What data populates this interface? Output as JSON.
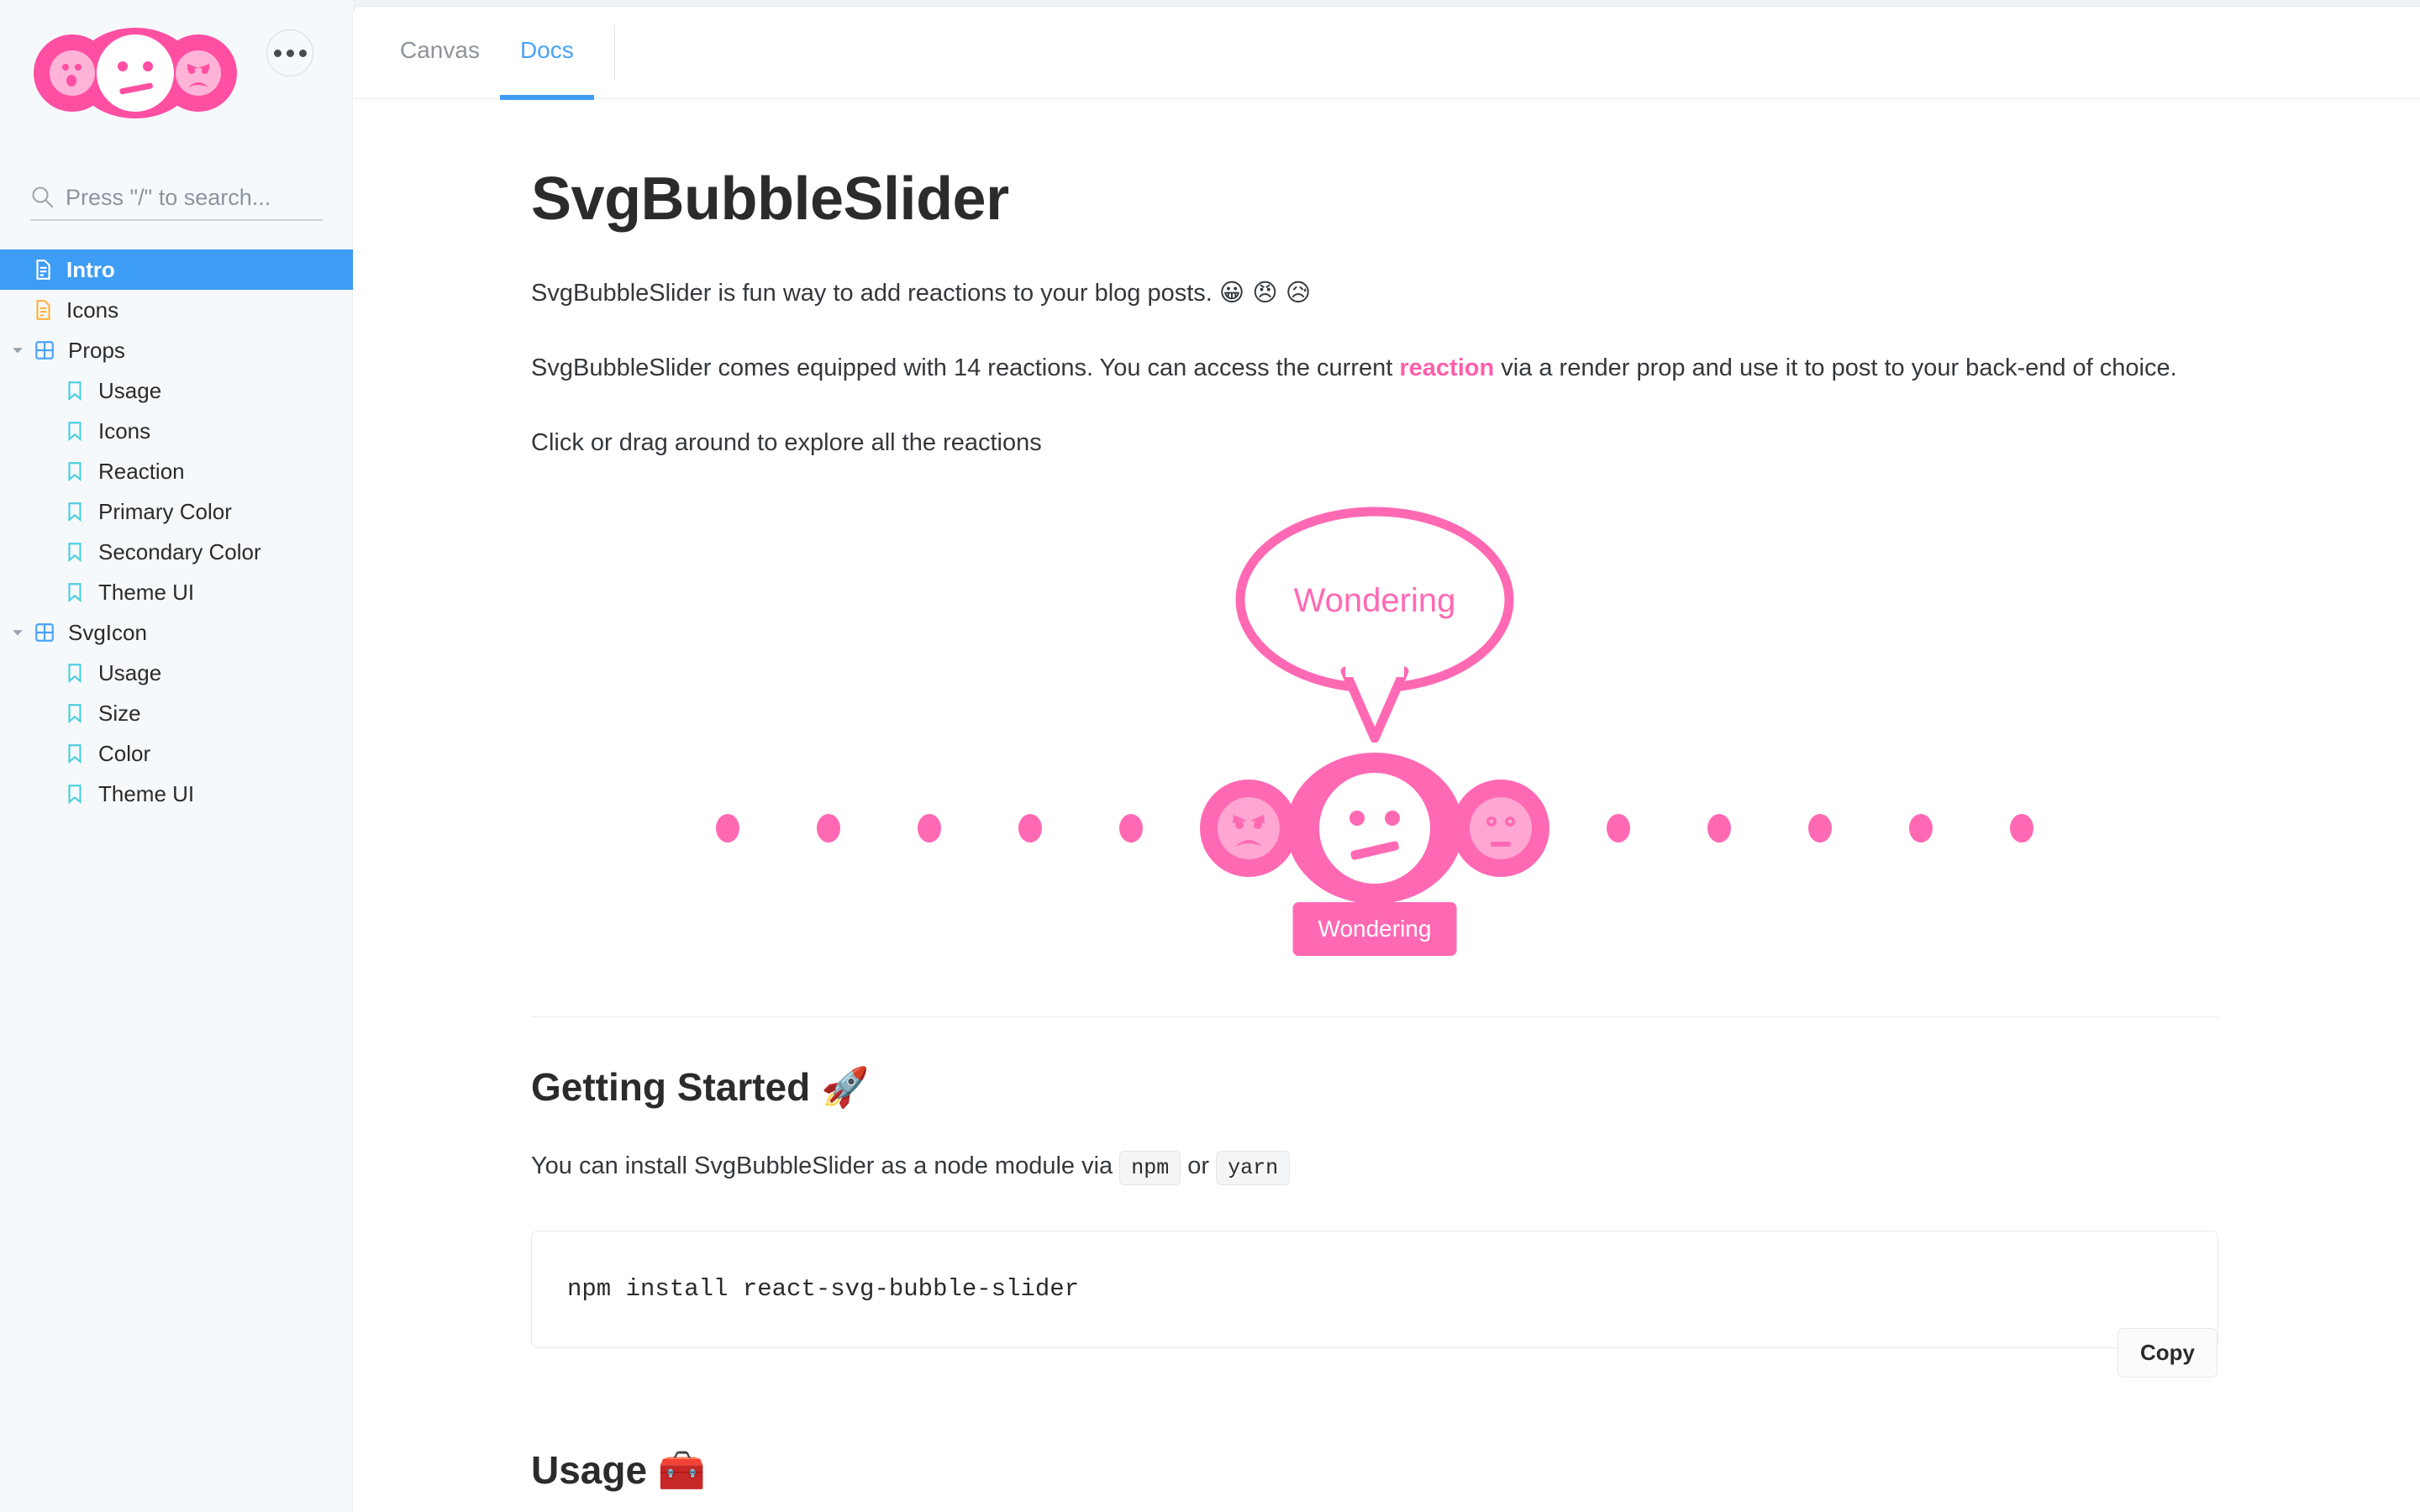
{
  "sidebar": {
    "logo_icon": "bubble-faces-logo",
    "more_button_icon": "ellipsis-icon",
    "search": {
      "icon": "search-icon",
      "placeholder": "Press \"/\" to search...",
      "value": ""
    },
    "items": [
      {
        "label": "Intro",
        "icon": "document-icon",
        "depth": 0,
        "active": true,
        "caret": false,
        "icon_color": "#ffffff"
      },
      {
        "label": "Icons",
        "icon": "document-icon",
        "depth": 0,
        "active": false,
        "caret": false,
        "icon_color": "#ffb23e"
      },
      {
        "label": "Props",
        "icon": "component-icon",
        "depth": 0,
        "active": false,
        "caret": true,
        "icon_color": "#4aa3f8"
      },
      {
        "label": "Usage",
        "icon": "bookmark-icon",
        "depth": 1,
        "active": false,
        "caret": false,
        "icon_color": "#4ecfe0"
      },
      {
        "label": "Icons",
        "icon": "bookmark-icon",
        "depth": 1,
        "active": false,
        "caret": false,
        "icon_color": "#4ecfe0"
      },
      {
        "label": "Reaction",
        "icon": "bookmark-icon",
        "depth": 1,
        "active": false,
        "caret": false,
        "icon_color": "#4ecfe0"
      },
      {
        "label": "Primary Color",
        "icon": "bookmark-icon",
        "depth": 1,
        "active": false,
        "caret": false,
        "icon_color": "#4ecfe0"
      },
      {
        "label": "Secondary Color",
        "icon": "bookmark-icon",
        "depth": 1,
        "active": false,
        "caret": false,
        "icon_color": "#4ecfe0"
      },
      {
        "label": "Theme UI",
        "icon": "bookmark-icon",
        "depth": 1,
        "active": false,
        "caret": false,
        "icon_color": "#4ecfe0"
      },
      {
        "label": "SvgIcon",
        "icon": "component-icon",
        "depth": 0,
        "active": false,
        "caret": true,
        "icon_color": "#4aa3f8"
      },
      {
        "label": "Usage",
        "icon": "bookmark-icon",
        "depth": 1,
        "active": false,
        "caret": false,
        "icon_color": "#4ecfe0"
      },
      {
        "label": "Size",
        "icon": "bookmark-icon",
        "depth": 1,
        "active": false,
        "caret": false,
        "icon_color": "#4ecfe0"
      },
      {
        "label": "Color",
        "icon": "bookmark-icon",
        "depth": 1,
        "active": false,
        "caret": false,
        "icon_color": "#4ecfe0"
      },
      {
        "label": "Theme UI",
        "icon": "bookmark-icon",
        "depth": 1,
        "active": false,
        "caret": false,
        "icon_color": "#4ecfe0"
      }
    ]
  },
  "tabs": [
    {
      "label": "Canvas",
      "active": false
    },
    {
      "label": "Docs",
      "active": true
    }
  ],
  "doc": {
    "title": "SvgBubbleSlider",
    "para1_text": "SvgBubbleSlider is fun way to add reactions to your blog posts. ",
    "para1_emojis": "😀 😠 😥",
    "para2_before": "SvgBubbleSlider comes equipped with 14 reactions. You can access the current ",
    "para2_link": "reaction",
    "para2_after": " via a render prop and use it to post to your back-end of choice.",
    "para3": "Click or drag around to explore all the reactions",
    "demo": {
      "bubble_text": "Wondering",
      "reaction_label": "Wondering",
      "left_dots": 5,
      "right_dots": 5,
      "faces": [
        {
          "name": "angry-face",
          "state": "inactive"
        },
        {
          "name": "wondering-face",
          "state": "active"
        },
        {
          "name": "neutral-face",
          "state": "inactive"
        }
      ],
      "primary_color": "#ff69b4",
      "secondary_color": "#ffffff"
    },
    "getting_started": {
      "heading": "Getting Started ",
      "heading_emoji": "🚀",
      "install_before": "You can install SvgBubbleSlider as a node module via ",
      "chip_npm": "npm",
      "install_or": " or ",
      "chip_yarn": "yarn",
      "code": "npm install react-svg-bubble-slider",
      "copy_label": "Copy"
    },
    "usage": {
      "heading": "Usage ",
      "heading_emoji": "🧰"
    }
  }
}
